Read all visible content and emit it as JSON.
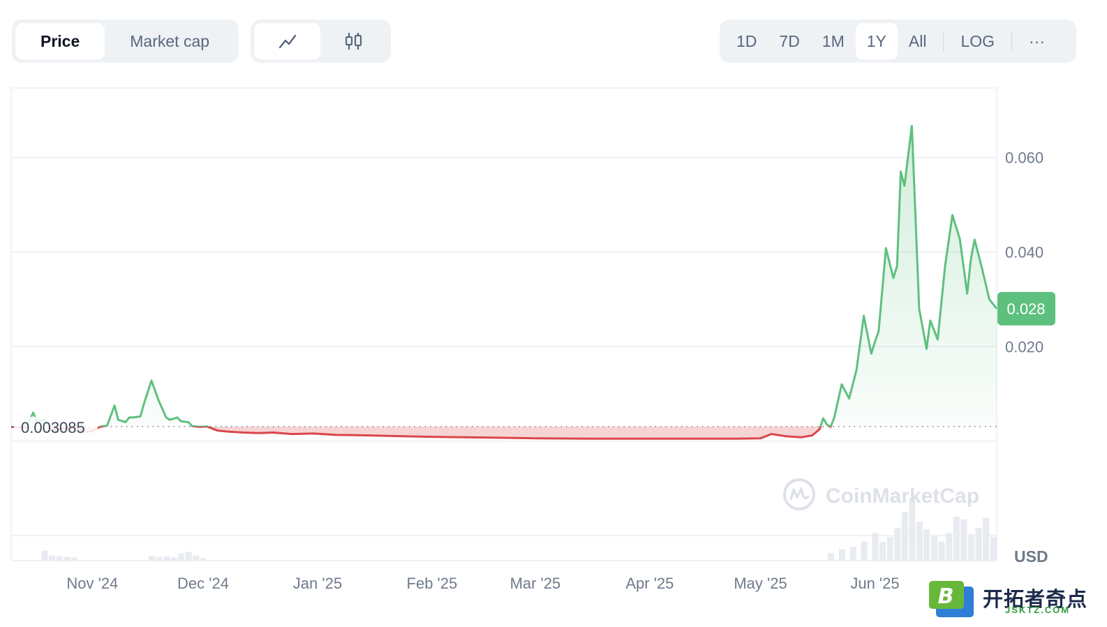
{
  "toolbar": {
    "type_options": [
      "Price",
      "Market cap"
    ],
    "active_type": "Price",
    "chart_modes": [
      "line-chart-icon",
      "candlestick-icon"
    ],
    "active_mode": "line-chart-icon",
    "ranges": [
      "1D",
      "7D",
      "1M",
      "1Y",
      "All"
    ],
    "active_range": "1Y",
    "log_label": "LOG",
    "more_label": "···"
  },
  "colors": {
    "up": "#16c784",
    "up_line": "#5ec07e",
    "down_line": "#d9474b",
    "down_fill": "#f4c9c9",
    "grid": "#eaedf1",
    "axis_text": "#6f7a8b",
    "badge_bg": "#5ec07e"
  },
  "watermark": {
    "brand": "CoinMarketCap",
    "site_title": "开拓者奇点",
    "site_sub": "JSKTZ.COM",
    "badge_letter": "B"
  },
  "chart_data": {
    "type": "line",
    "currency_label": "USD",
    "baseline_label": "0.003085",
    "baseline_value": 0.003085,
    "current_price_label": "0.028",
    "current_price": 0.028,
    "ylim": [
      -0.0253,
      0.0747
    ],
    "yticks": [
      0.02,
      0.04,
      0.06
    ],
    "ytick_labels": [
      "0.020",
      "0.040",
      "0.060"
    ],
    "xticks": [
      {
        "label": "Nov '24",
        "date": "2024-11-01"
      },
      {
        "label": "Dec '24",
        "date": "2024-12-01"
      },
      {
        "label": "Jan '25",
        "date": "2025-01-01"
      },
      {
        "label": "Feb '25",
        "date": "2025-02-01"
      },
      {
        "label": "Mar '25",
        "date": "2025-03-01"
      },
      {
        "label": "Apr '25",
        "date": "2025-04-01"
      },
      {
        "label": "May '25",
        "date": "2025-05-01"
      },
      {
        "label": "Jun '25",
        "date": "2025-06-01"
      }
    ],
    "x_start": "2024-10-10",
    "x_end": "2025-07-04",
    "series": [
      {
        "dates": [
          "2024-10-10",
          "2024-10-14",
          "2024-10-16",
          "2024-10-17",
          "2024-10-19",
          "2024-10-21",
          "2024-10-22",
          "2024-10-24",
          "2024-10-26",
          "2024-10-28",
          "2024-10-30",
          "2024-11-01",
          "2024-11-03",
          "2024-11-05",
          "2024-11-07",
          "2024-11-08",
          "2024-11-10",
          "2024-11-11",
          "2024-11-12",
          "2024-11-14",
          "2024-11-15",
          "2024-11-17",
          "2024-11-19",
          "2024-11-21",
          "2024-11-22",
          "2024-11-24",
          "2024-11-25",
          "2024-11-27",
          "2024-11-28",
          "2024-11-30",
          "2024-12-02",
          "2024-12-05",
          "2024-12-08",
          "2024-12-12",
          "2024-12-16",
          "2024-12-20",
          "2024-12-25",
          "2024-12-31",
          "2025-01-06",
          "2025-01-15",
          "2025-01-25",
          "2025-02-01",
          "2025-02-10",
          "2025-02-20",
          "2025-03-01",
          "2025-03-15",
          "2025-04-01",
          "2025-04-15",
          "2025-04-25",
          "2025-05-01",
          "2025-05-04",
          "2025-05-08",
          "2025-05-12",
          "2025-05-15",
          "2025-05-17",
          "2025-05-18",
          "2025-05-19",
          "2025-05-20",
          "2025-05-21",
          "2025-05-23",
          "2025-05-25",
          "2025-05-27",
          "2025-05-29",
          "2025-05-31",
          "2025-06-01",
          "2025-06-02",
          "2025-06-04",
          "2025-06-06",
          "2025-06-07",
          "2025-06-08",
          "2025-06-09",
          "2025-06-11",
          "2025-06-13",
          "2025-06-15",
          "2025-06-16",
          "2025-06-18",
          "2025-06-20",
          "2025-06-22",
          "2025-06-24",
          "2025-06-26",
          "2025-06-27",
          "2025-06-28",
          "2025-06-30",
          "2025-07-02",
          "2025-07-04"
        ],
        "values": [
          0.003,
          0.0029,
          0.006,
          0.004,
          0.0046,
          0.0023,
          0.0025,
          0.0026,
          0.0029,
          0.0026,
          0.002,
          0.0021,
          0.003,
          0.0033,
          0.0075,
          0.0045,
          0.004,
          0.005,
          0.005,
          0.0052,
          0.008,
          0.0128,
          0.0085,
          0.005,
          0.0045,
          0.005,
          0.0042,
          0.004,
          0.0032,
          0.003,
          0.0031,
          0.0022,
          0.002,
          0.0018,
          0.0017,
          0.0018,
          0.0015,
          0.0016,
          0.0013,
          0.0012,
          0.001,
          0.0009,
          0.0008,
          0.0007,
          0.0006,
          0.0005,
          0.0005,
          0.0005,
          0.0005,
          0.0006,
          0.0015,
          0.001,
          0.0008,
          0.0012,
          0.0025,
          0.0048,
          0.0035,
          0.003,
          0.005,
          0.012,
          0.009,
          0.015,
          0.0265,
          0.0185,
          0.021,
          0.0232,
          0.0408,
          0.0345,
          0.037,
          0.057,
          0.054,
          0.0667,
          0.028,
          0.0195,
          0.0255,
          0.0215,
          0.037,
          0.0478,
          0.0428,
          0.0312,
          0.0385,
          0.0426,
          0.0366,
          0.03,
          0.028
        ]
      }
    ],
    "volume": [
      {
        "date": "2024-10-19",
        "value": 0.16
      },
      {
        "date": "2024-10-21",
        "value": 0.08
      },
      {
        "date": "2024-10-23",
        "value": 0.07
      },
      {
        "date": "2024-10-25",
        "value": 0.06
      },
      {
        "date": "2024-10-27",
        "value": 0.05
      },
      {
        "date": "2024-11-17",
        "value": 0.08
      },
      {
        "date": "2024-11-19",
        "value": 0.06
      },
      {
        "date": "2024-11-21",
        "value": 0.07
      },
      {
        "date": "2024-11-23",
        "value": 0.05
      },
      {
        "date": "2024-11-25",
        "value": 0.12
      },
      {
        "date": "2024-11-27",
        "value": 0.14
      },
      {
        "date": "2024-11-29",
        "value": 0.08
      },
      {
        "date": "2024-12-01",
        "value": 0.04
      },
      {
        "date": "2025-05-20",
        "value": 0.12
      },
      {
        "date": "2025-05-23",
        "value": 0.18
      },
      {
        "date": "2025-05-26",
        "value": 0.22
      },
      {
        "date": "2025-05-29",
        "value": 0.3
      },
      {
        "date": "2025-06-01",
        "value": 0.44
      },
      {
        "date": "2025-06-03",
        "value": 0.3
      },
      {
        "date": "2025-06-05",
        "value": 0.38
      },
      {
        "date": "2025-06-07",
        "value": 0.52
      },
      {
        "date": "2025-06-09",
        "value": 0.78
      },
      {
        "date": "2025-06-11",
        "value": 1.0
      },
      {
        "date": "2025-06-13",
        "value": 0.62
      },
      {
        "date": "2025-06-15",
        "value": 0.5
      },
      {
        "date": "2025-06-17",
        "value": 0.4
      },
      {
        "date": "2025-06-19",
        "value": 0.3
      },
      {
        "date": "2025-06-21",
        "value": 0.44
      },
      {
        "date": "2025-06-23",
        "value": 0.7
      },
      {
        "date": "2025-06-25",
        "value": 0.66
      },
      {
        "date": "2025-06-27",
        "value": 0.42
      },
      {
        "date": "2025-06-29",
        "value": 0.52
      },
      {
        "date": "2025-07-01",
        "value": 0.68
      },
      {
        "date": "2025-07-03",
        "value": 0.38
      }
    ]
  }
}
